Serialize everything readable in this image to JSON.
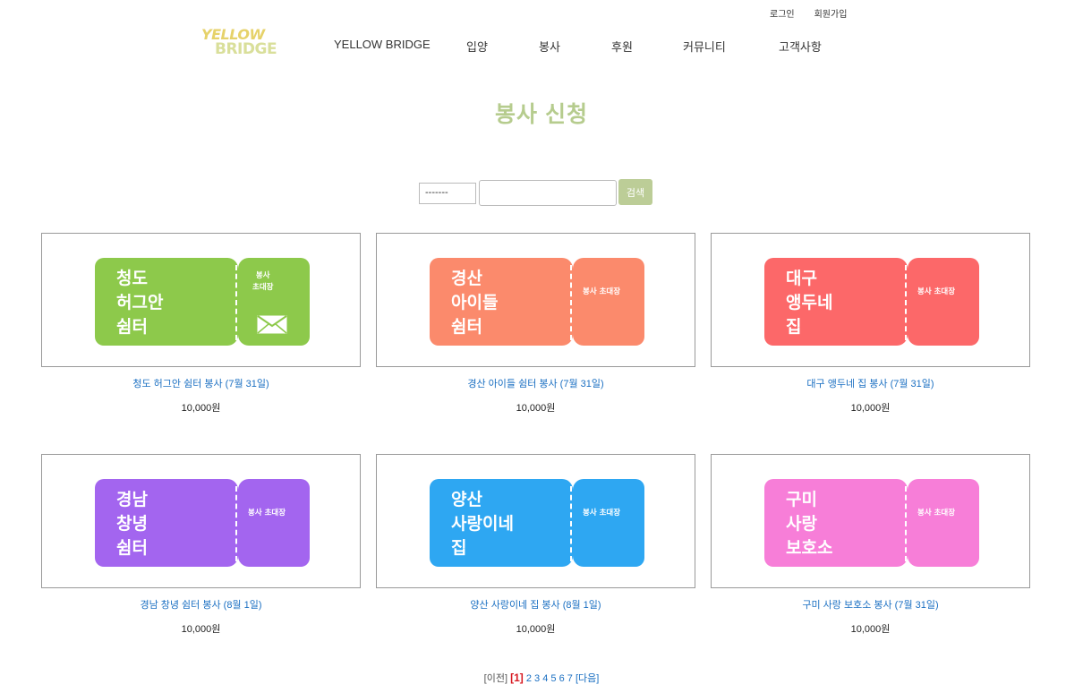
{
  "header": {
    "login_label": "로그인",
    "signup_label": "회원가입",
    "logo_line1": "YELLOW",
    "logo_line2": "BRIDGE",
    "nav": [
      "YELLOW BRIDGE",
      "입양",
      "봉사",
      "후원",
      "커뮤니티",
      "고객사항"
    ]
  },
  "page": {
    "title": "봉사 신청"
  },
  "search": {
    "select_value": "-------",
    "input_value": "",
    "button_label": "검색"
  },
  "cards": [
    {
      "title": "청도 허그안 쉼터 봉사 (7월 31일)",
      "price": "10,000원",
      "ticket_text": "청도\n허그안\n쉼터",
      "stub_text": "봉사\n초대장",
      "color": "#8dc94b",
      "has_envelope": true,
      "envelope_icon": "envelope-icon"
    },
    {
      "title": "경산 아이들 쉼터 봉사 (7월 31일)",
      "price": "10,000원",
      "ticket_text": "경산\n아이들\n쉼터",
      "stub_text": "봉사 초대장",
      "color": "#fb8a6c",
      "has_envelope": false
    },
    {
      "title": "대구 앵두네 집 봉사 (7월 31일)",
      "price": "10,000원",
      "ticket_text": "대구\n앵두네\n집",
      "stub_text": "봉사 초대장",
      "color": "#fc6869",
      "has_envelope": false
    },
    {
      "title": "경남 창녕 쉼터 봉사 (8월 1일)",
      "price": "10,000원",
      "ticket_text": "경남\n창녕\n쉼터",
      "stub_text": "봉사 초대장",
      "color": "#a365ef",
      "has_envelope": false
    },
    {
      "title": "양산 사랑이네 집 봉사 (8월 1일)",
      "price": "10,000원",
      "ticket_text": "양산\n사랑이네\n집",
      "stub_text": "봉사 초대장",
      "color": "#2ea7f2",
      "has_envelope": false
    },
    {
      "title": "구미 사랑 보호소 봉사 (7월 31일)",
      "price": "10,000원",
      "ticket_text": "구미\n사랑\n보호소",
      "stub_text": "봉사 초대장",
      "color": "#f77ed8",
      "has_envelope": false
    }
  ],
  "pagination": {
    "prev_label": "[이전]",
    "current": "[1]",
    "pages": [
      "2",
      "3",
      "4",
      "5",
      "6",
      "7"
    ],
    "next_label": "[다음]"
  }
}
